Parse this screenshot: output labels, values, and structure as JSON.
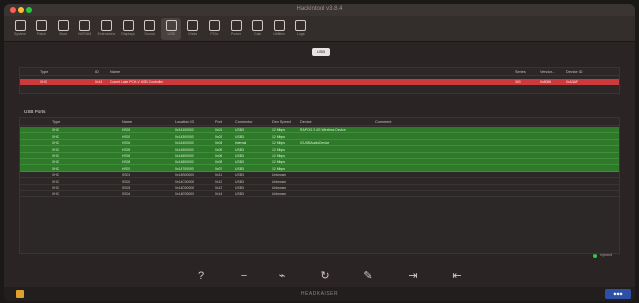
{
  "window": {
    "title": "Hackintool v3.8.4"
  },
  "toolbar": {
    "items": [
      {
        "label": "System",
        "icon": "monitor-icon"
      },
      {
        "label": "Patch",
        "icon": "pencil-icon"
      },
      {
        "label": "Boot",
        "icon": "boot-icon"
      },
      {
        "label": "NVRAM",
        "icon": "chip-icon"
      },
      {
        "label": "Extensions",
        "icon": "gear-icon"
      },
      {
        "label": "Displays",
        "icon": "display-icon"
      },
      {
        "label": "Sound",
        "icon": "speaker-icon"
      },
      {
        "label": "USB",
        "icon": "usb-icon"
      },
      {
        "label": "Disks",
        "icon": "disk-icon"
      },
      {
        "label": "PCIe",
        "icon": "card-icon"
      },
      {
        "label": "Power",
        "icon": "power-icon"
      },
      {
        "label": "Calc",
        "icon": "calculator-icon"
      },
      {
        "label": "Utilities",
        "icon": "wrench-icon"
      },
      {
        "label": "Logs",
        "icon": "document-icon"
      }
    ],
    "active": "USB"
  },
  "segmented": {
    "label": "USB"
  },
  "controllers": {
    "columns": [
      "Type",
      "ID",
      "Name",
      "Series",
      "Vendor...",
      "Device ID"
    ],
    "rows": [
      [
        "XHC",
        "0x14",
        "Comet Lake PCH-V USB Controller",
        "300",
        "0x8086",
        "0xA3AF"
      ]
    ]
  },
  "ports_section": {
    "title": "USB Ports"
  },
  "ports": {
    "columns": [
      "Type",
      "Name",
      "Location ID",
      "Port",
      "Connector",
      "Dev Speed",
      "Device",
      "Comment"
    ],
    "rows": [
      {
        "state": "green",
        "cells": [
          "XHC",
          "HS01",
          "0x14100000",
          "0x01",
          "USB3",
          "12 Mbps",
          "RAPOO 2.4G Wireless Device",
          ""
        ]
      },
      {
        "state": "green",
        "cells": [
          "XHC",
          "HS03",
          "0x14300000",
          "0x03",
          "USB3",
          "12 Mbps",
          "",
          ""
        ]
      },
      {
        "state": "green",
        "cells": [
          "XHC",
          "HS04",
          "0x14400000",
          "0x04",
          "Internal",
          "12 Mbps",
          "ICUSBAudioDevice",
          ""
        ]
      },
      {
        "state": "green",
        "cells": [
          "XHC",
          "HS05",
          "0x14500000",
          "0x05",
          "USB3",
          "12 Mbps",
          "",
          ""
        ]
      },
      {
        "state": "green",
        "cells": [
          "XHC",
          "HS06",
          "0x14600000",
          "0x06",
          "USB3",
          "12 Mbps",
          "",
          ""
        ]
      },
      {
        "state": "green",
        "cells": [
          "XHC",
          "HS08",
          "0x14800000",
          "0x08",
          "USB3",
          "12 Mbps",
          "",
          ""
        ]
      },
      {
        "state": "green",
        "cells": [
          "XHC",
          "HS07",
          "0x14700000",
          "0x07",
          "USB3",
          "12 Mbps",
          "",
          ""
        ]
      },
      {
        "state": "dark",
        "cells": [
          "XHC",
          "SS01",
          "0x14B00000",
          "0x11",
          "USB3",
          "Unknown",
          "",
          ""
        ]
      },
      {
        "state": "dark",
        "cells": [
          "XHC",
          "SS02",
          "0x14C00000",
          "0x12",
          "USB3",
          "Unknown",
          "",
          ""
        ]
      },
      {
        "state": "dark",
        "cells": [
          "XHC",
          "SS03",
          "0x14D00000",
          "0x13",
          "USB3",
          "Unknown",
          "",
          ""
        ]
      },
      {
        "state": "dark",
        "cells": [
          "XHC",
          "SS04",
          "0x14E00000",
          "0x14",
          "USB3",
          "Unknown",
          "",
          ""
        ]
      }
    ]
  },
  "status": {
    "label": "Injected"
  },
  "bottom_toolbar": {
    "buttons": [
      {
        "name": "help-button",
        "icon": "question-icon",
        "glyph": "?"
      },
      {
        "name": "remove-button",
        "icon": "minus-icon",
        "glyph": "−"
      },
      {
        "name": "clear-button",
        "icon": "broom-icon",
        "glyph": "⌁"
      },
      {
        "name": "refresh-button",
        "icon": "refresh-icon",
        "glyph": "↻"
      },
      {
        "name": "edit-button",
        "icon": "pencil-icon",
        "glyph": "✎"
      },
      {
        "name": "import-button",
        "icon": "import-icon",
        "glyph": "⇥"
      },
      {
        "name": "export-button",
        "icon": "export-icon",
        "glyph": "⇤"
      }
    ]
  },
  "footer": {
    "text": "HEADKAISER"
  },
  "colors": {
    "controller_row": "#cc3a3e",
    "active_port_row": "#2e7a2a",
    "status_dot": "#2ecc40"
  }
}
